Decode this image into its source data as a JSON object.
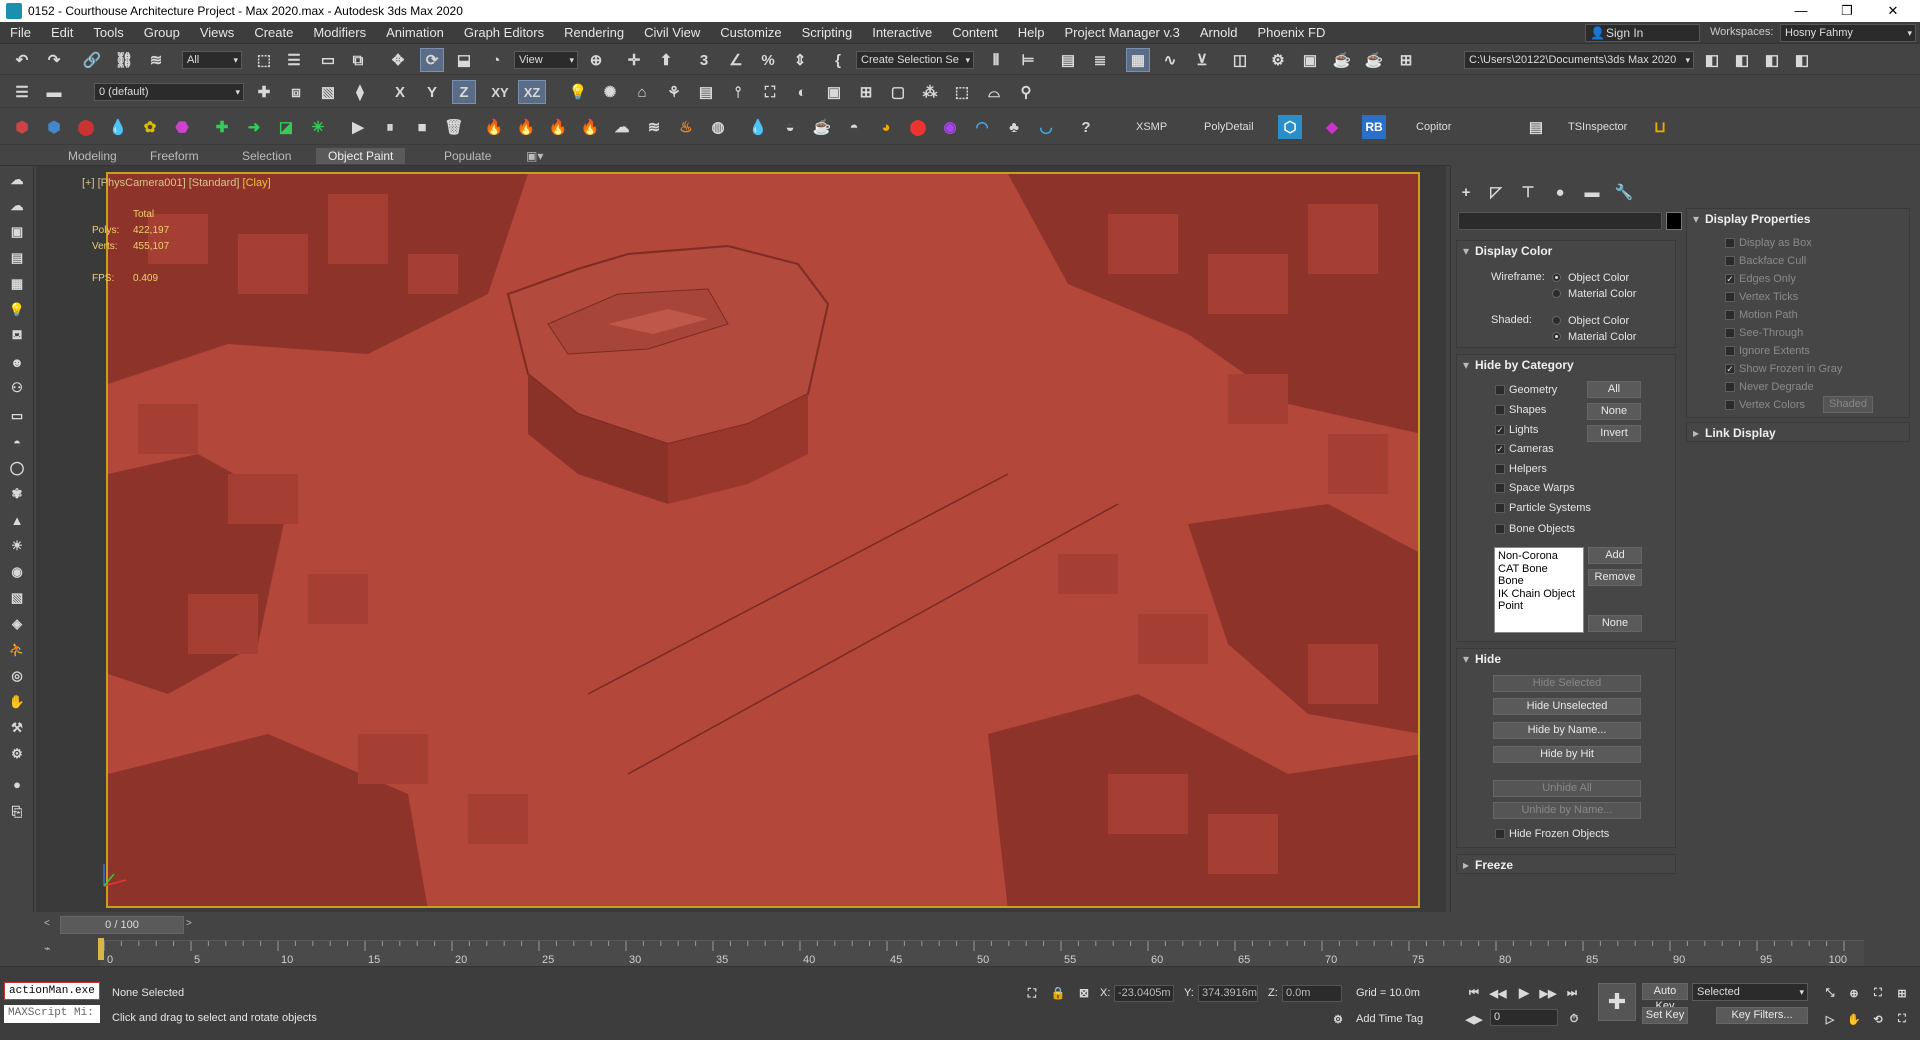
{
  "window": {
    "title": "0152 - Courthouse Architecture Project - Max 2020.max - Autodesk 3ds Max 2020",
    "controls": [
      "—",
      "❐",
      "✕"
    ]
  },
  "menubar": {
    "items": [
      "File",
      "Edit",
      "Tools",
      "Group",
      "Views",
      "Create",
      "Modifiers",
      "Animation",
      "Graph Editors",
      "Rendering",
      "Civil View",
      "Customize",
      "Scripting",
      "Interactive",
      "Content",
      "Help",
      "Project Manager v.3",
      "Arnold",
      "Phoenix FD"
    ],
    "sign_in": "Sign In",
    "workspaces_label": "Workspaces:",
    "workspace_value": "Hosny Fahmy"
  },
  "toolbar_main": {
    "selection_filter": "All",
    "view_dropdown": "View",
    "selection_set": "Create Selection Se",
    "project_path": "C:\\Users\\20122\\Documents\\3ds Max 2020"
  },
  "toolbar_second": {
    "layer_dropdown": "0 (default)",
    "axis_x": "X",
    "axis_y": "Y",
    "axis_z": "Z",
    "axis_xy": "XY",
    "axis_xz": "XZ"
  },
  "toolbar_third": {
    "xsmp": "XSMP",
    "polydetail": "PolyDetail",
    "rb": "RB",
    "copitor": "Copitor",
    "tsinspector": "TSInspector"
  },
  "ribbon": {
    "tabs": [
      "Modeling",
      "Freeform",
      "Selection",
      "Object Paint",
      "Populate"
    ],
    "active": "Object Paint"
  },
  "viewport": {
    "label_prefix": "[+]",
    "label_camera": "[PhysCamera001]",
    "label_shading": "[Standard]",
    "label_style": "[Clay]",
    "stats_total": "Total",
    "polys_label": "Polys:",
    "polys_value": "422,197",
    "verts_label": "Verts:",
    "verts_value": "455,107",
    "fps_label": "FPS:",
    "fps_value": "0.409"
  },
  "command_panel": {
    "display_color": {
      "title": "Display Color",
      "wireframe_label": "Wireframe:",
      "shaded_label": "Shaded:",
      "object_color": "Object Color",
      "material_color": "Material Color"
    },
    "hide_by_category": {
      "title": "Hide by Category",
      "items": [
        {
          "label": "Geometry",
          "checked": false
        },
        {
          "label": "Shapes",
          "checked": false
        },
        {
          "label": "Lights",
          "checked": true
        },
        {
          "label": "Cameras",
          "checked": true
        },
        {
          "label": "Helpers",
          "checked": false
        },
        {
          "label": "Space Warps",
          "checked": false
        },
        {
          "label": "Particle Systems",
          "checked": false
        },
        {
          "label": "Bone Objects",
          "checked": false
        }
      ],
      "btn_all": "All",
      "btn_none": "None",
      "btn_invert": "Invert",
      "list": [
        "Non-Corona",
        "CAT Bone",
        "Bone",
        "IK Chain Object",
        "Point"
      ],
      "btn_add": "Add",
      "btn_remove": "Remove",
      "btn_none2": "None"
    },
    "hide": {
      "title": "Hide",
      "hide_selected": "Hide Selected",
      "hide_unselected": "Hide Unselected",
      "hide_by_name": "Hide by Name...",
      "hide_by_hit": "Hide by Hit",
      "unhide_all": "Unhide All",
      "unhide_by_name": "Unhide by Name...",
      "hide_frozen": "Hide Frozen Objects"
    },
    "freeze": {
      "title": "Freeze"
    },
    "display_properties": {
      "title": "Display Properties",
      "items": [
        {
          "label": "Display as Box",
          "checked": false
        },
        {
          "label": "Backface Cull",
          "checked": false
        },
        {
          "label": "Edges Only",
          "checked": true
        },
        {
          "label": "Vertex Ticks",
          "checked": false
        },
        {
          "label": "Motion Path",
          "checked": false
        },
        {
          "label": "See-Through",
          "checked": false
        },
        {
          "label": "Ignore Extents",
          "checked": false
        },
        {
          "label": "Show Frozen in Gray",
          "checked": true
        },
        {
          "label": "Never Degrade",
          "checked": false
        },
        {
          "label": "Vertex Colors",
          "checked": false
        }
      ],
      "shaded_btn": "Shaded"
    },
    "link_display": {
      "title": "Link Display"
    }
  },
  "timeline": {
    "frame_counter": "0 / 100",
    "ticks": [
      "0",
      "5",
      "10",
      "15",
      "20",
      "25",
      "30",
      "35",
      "40",
      "45",
      "50",
      "55",
      "60",
      "65",
      "70",
      "75",
      "80",
      "85",
      "90",
      "95",
      "100"
    ]
  },
  "statusbar": {
    "script_listener": "actionMan.exe",
    "maxscript_mini": "MAXScript Mi:",
    "selection_status": "None Selected",
    "prompt": "Click and drag to select and rotate objects",
    "x_label": "X:",
    "x_value": "-23.0405m",
    "y_label": "Y:",
    "y_value": "374.3916m",
    "z_label": "Z:",
    "z_value": "0.0m",
    "grid": "Grid = 10.0m",
    "add_time_tag": "Add Time Tag",
    "auto_key": "Auto Key",
    "selected_dropdown": "Selected",
    "set_key": "Set Key",
    "key_filters": "Key Filters...",
    "frame_value": "0"
  }
}
